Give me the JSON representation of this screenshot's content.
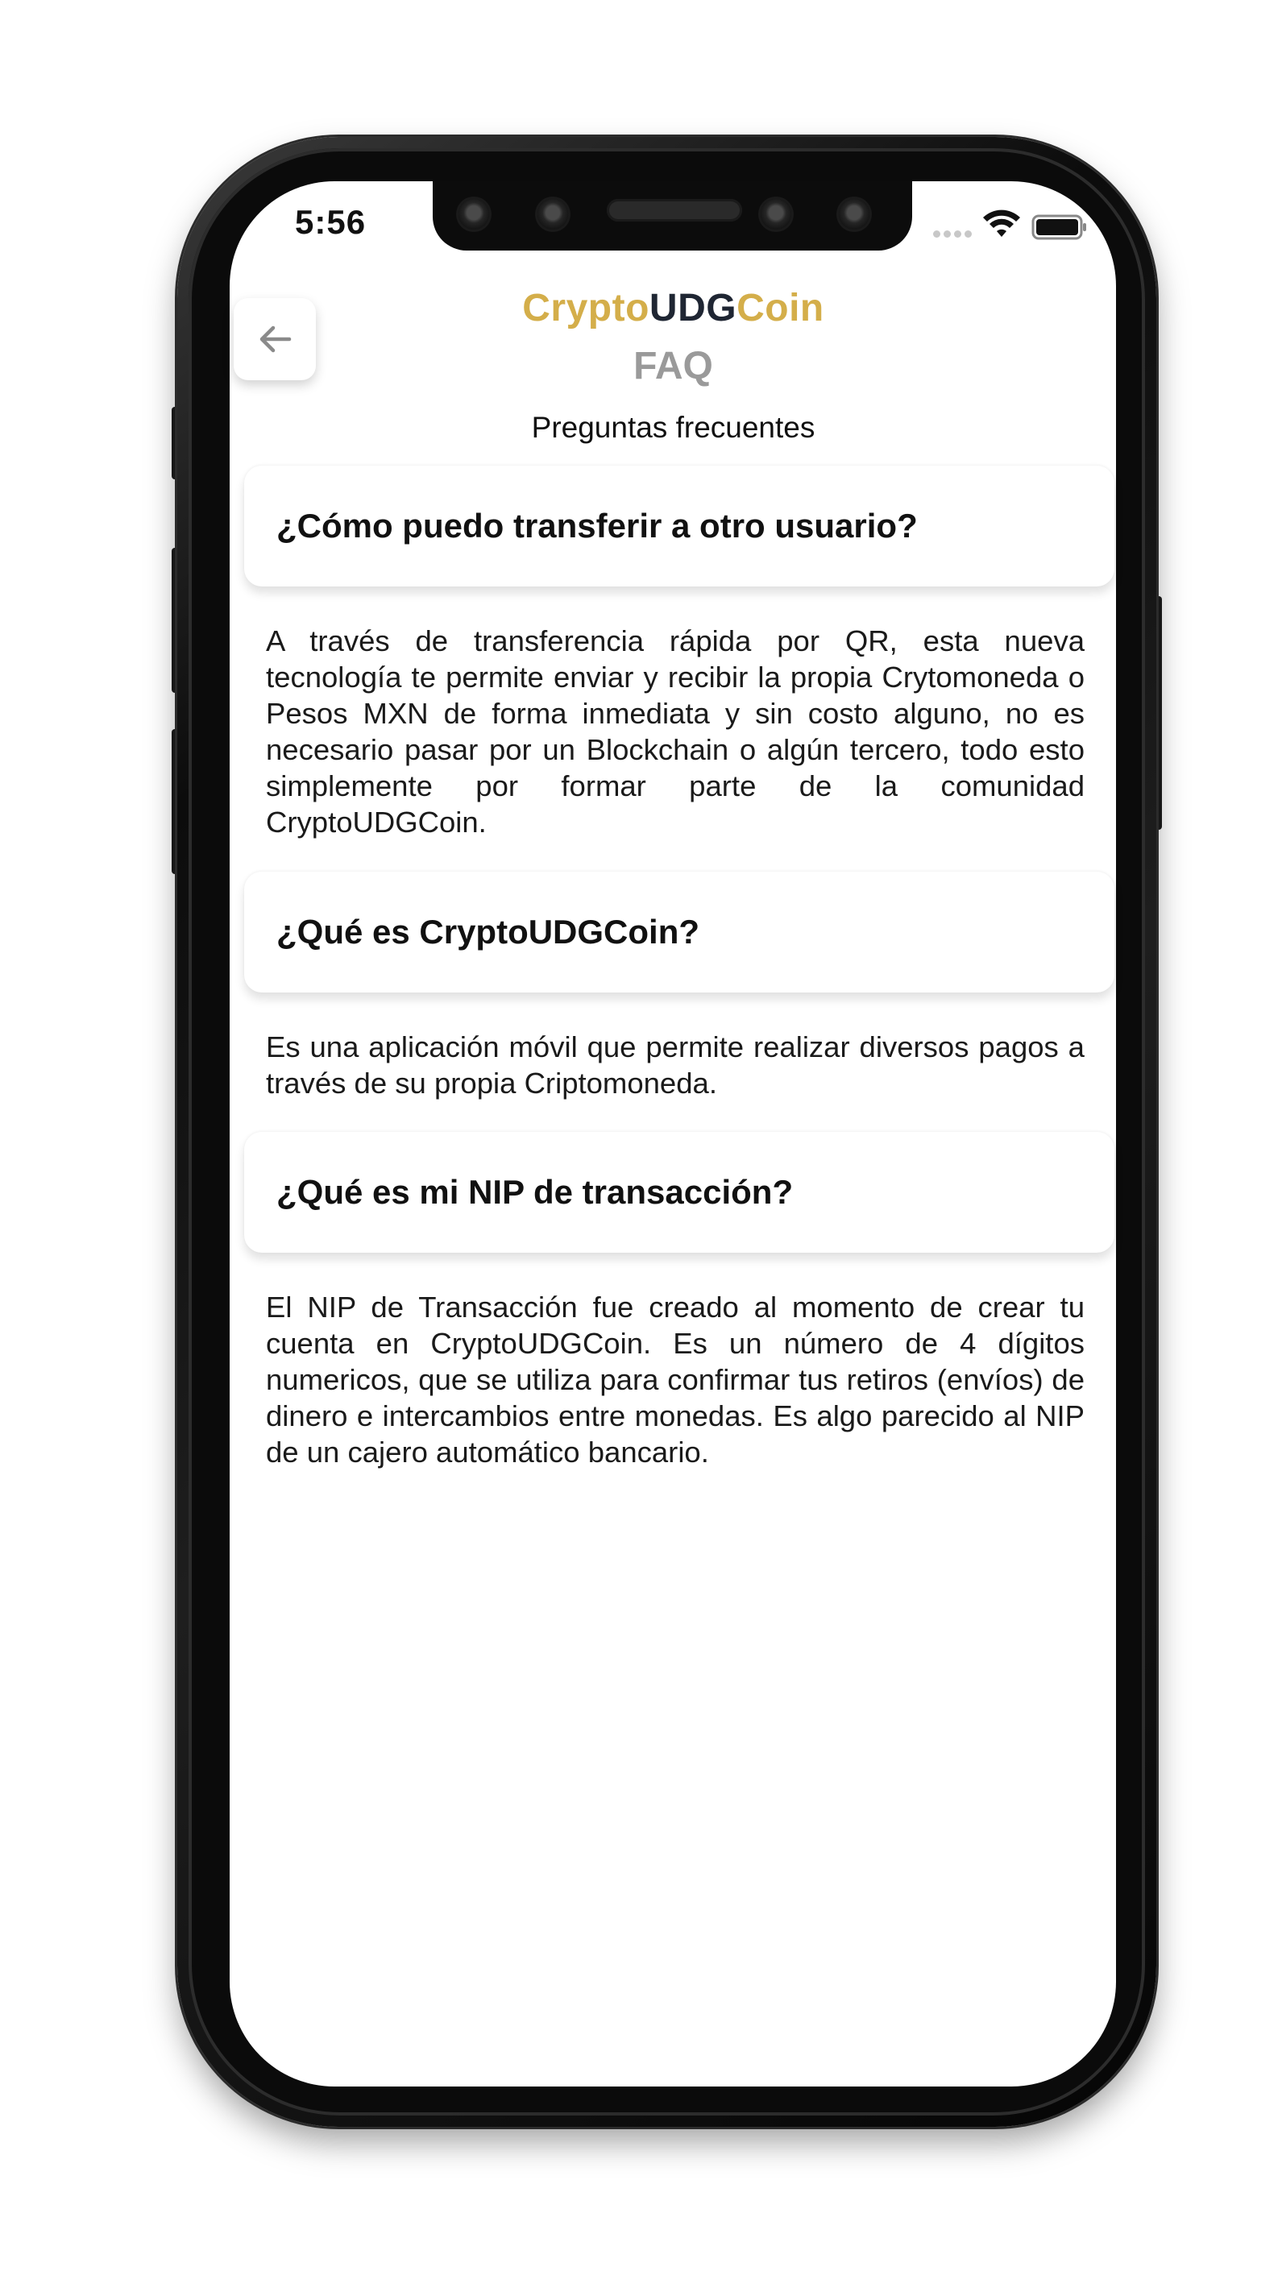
{
  "status_bar": {
    "time": "5:56"
  },
  "header": {
    "brand_part1": "Crypto",
    "brand_part2": "UDG",
    "brand_part3": "Coin",
    "title": "FAQ",
    "subtitle": "Preguntas frecuentes"
  },
  "faq": [
    {
      "question": "¿Cómo puedo transferir a otro usuario?",
      "answer": "A través de transferencia rápida por QR, esta nueva tecnología te permite enviar y recibir la propia Crytomoneda o Pesos MXN de forma inmediata y sin costo alguno, no es necesario pasar por un Blockchain o algún tercero, todo esto simplemente por formar parte de la comunidad CryptoUDGCoin."
    },
    {
      "question": "¿Qué es CryptoUDGCoin?",
      "answer": "Es una aplicación móvil que permite realizar diversos pagos a través de su propia Criptomoneda."
    },
    {
      "question": "¿Qué es mi NIP de transacción?",
      "answer": "El NIP de Transacción fue creado al momento de crear tu cuenta en CryptoUDGCoin. Es un número de 4 dígitos numericos, que se utiliza para confirmar tus retiros (envíos) de dinero e intercambios entre monedas. Es algo parecido al NIP de un cajero automático bancario."
    }
  ],
  "colors": {
    "brand_gold": "#d4ae4a",
    "brand_dark": "#1f2633",
    "faq_gray": "#9a9a9a"
  },
  "icons": {
    "back": "arrow-left-icon",
    "wifi": "wifi-icon",
    "battery": "battery-icon",
    "signal": "signal-dots-icon"
  }
}
